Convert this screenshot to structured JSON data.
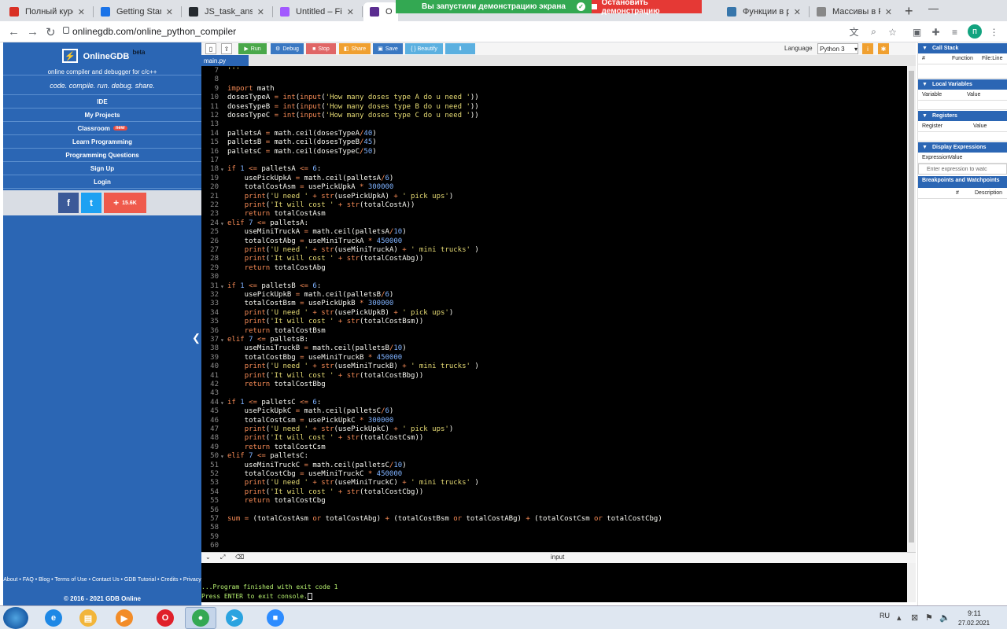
{
  "browser": {
    "tabs": [
      {
        "title": "Полный курс п",
        "icon": "edu-icon",
        "color": "#d93025"
      },
      {
        "title": "Getting Started",
        "icon": "globe-icon",
        "color": "#1a73e8"
      },
      {
        "title": "JS_task_answer",
        "icon": "github-icon",
        "color": "#24292e"
      },
      {
        "title": "Untitled – Figm",
        "icon": "figma-icon",
        "color": "#a259ff"
      },
      {
        "title": "Onli",
        "icon": "onlinegdb-icon",
        "color": "#5b2d90",
        "active": true
      },
      {
        "title": "Функции в pyth",
        "icon": "python-icon",
        "color": "#3776ab"
      },
      {
        "title": "Массивы в Pyth",
        "icon": "bookmark-icon",
        "color": "#888888"
      }
    ],
    "demo_banner": {
      "message": "Вы запустили демонстрацию экрана",
      "stop": "Остановить демонстрацию"
    },
    "url": "onlinegdb.com/online_python_compiler",
    "profile_initial": "п"
  },
  "sidebar": {
    "brand": "OnlineGDB",
    "beta": "beta",
    "subtitle": "online compiler and debugger for c/c++",
    "tagline": "code. compile. run. debug. share.",
    "items": [
      "IDE",
      "My Projects",
      "Classroom",
      "Learn Programming",
      "Programming Questions",
      "Sign Up",
      "Login"
    ],
    "new_badge": "new",
    "share_count": "15.6K",
    "footer_links": "About • FAQ • Blog • Terms of Use • Contact Us • GDB Tutorial • Credits • Privacy",
    "copyright": "© 2016 - 2021 GDB Online"
  },
  "toolbar": {
    "run": "Run",
    "debug": "Debug",
    "stop": "Stop",
    "share": "Share",
    "save": "Save",
    "beautify": "{ } Beautify",
    "language_label": "Language",
    "language": "Python 3",
    "colors": {
      "run": "#4aa84a",
      "debug": "#3a78c2",
      "stop": "#e06666",
      "share": "#f0a030",
      "save": "#3a78c2",
      "beautify": "#5bb0e0",
      "download": "#5bb0e0"
    }
  },
  "file_tab": "main.py",
  "code": {
    "first_line": 7,
    "lines": [
      "'''",
      "",
      "import math",
      "dosesTypeA = int(input('How many doses type A do u need '))",
      "dosesTypeB = int(input('How many doses type B do u need '))",
      "dosesTypeC = int(input('How many doses type C do u need '))",
      "",
      "palletsA = math.ceil(dosesTypeA/40)",
      "palletsB = math.ceil(dosesTypeB/45)",
      "palletsC = math.ceil(dosesTypeC/50)",
      "",
      "if 1 <= palletsA <= 6:",
      "    usePickUpkA = math.ceil(palletsA/6)",
      "    totalCostAsm = usePickUpkA * 300000",
      "    print('U need ' + str(usePickUpkA) + ' pick ups')",
      "    print('It will cost ' + str(totalCostA))",
      "    return totalCostAsm",
      "elif 7 <= palletsA:",
      "    useMiniTruckA = math.ceil(palletsA/10)",
      "    totalCostAbg = useMiniTruckA * 450000",
      "    print('U need ' + str(useMiniTruckA) + ' mini trucks' )",
      "    print('It will cost ' + str(totalCostAbg))",
      "    return totalCostAbg",
      "",
      "if 1 <= palletsB <= 6:",
      "    usePickUpkB = math.ceil(palletsB/6)",
      "    totalCostBsm = usePickUpkB * 300000",
      "    print('U need ' + str(usePickUpkB) + ' pick ups')",
      "    print('It will cost ' + str(totalCostBsm))",
      "    return totalCostBsm",
      "elif 7 <= palletsB:",
      "    useMiniTruckB = math.ceil(palletsB/10)",
      "    totalCostBbg = useMiniTruckB * 450000",
      "    print('U need ' + str(useMiniTruckB) + ' mini trucks' )",
      "    print('It will cost ' + str(totalCostBbg))",
      "    return totalCostBbg",
      "",
      "if 1 <= palletsC <= 6:",
      "    usePickUpkC = math.ceil(palletsC/6)",
      "    totalCostCsm = usePickUpkC * 300000",
      "    print('U need ' + str(usePickUpkC) + ' pick ups')",
      "    print('It will cost ' + str(totalCostCsm))",
      "    return totalCostCsm",
      "elif 7 <= palletsC:",
      "    useMiniTruckC = math.ceil(palletsC/10)",
      "    totalCostCbg = useMiniTruckC * 450000",
      "    print('U need ' + str(useMiniTruckC) + ' mini trucks' )",
      "    print('It will cost ' + str(totalCostCbg))",
      "    return totalCostCbg",
      "",
      "sum = (totalCostAsm or totalCostAbg) + (totalCostBsm or totalCostABg) + (totalCostCsm or totalCostCbg)",
      "",
      "",
      ""
    ]
  },
  "console": {
    "label": "input",
    "line1": "...Program finished with exit code 1",
    "line2": "Press ENTER to exit console."
  },
  "debug_panel": {
    "call_stack": "Call Stack",
    "cs_cols": [
      "#",
      "Function",
      "File:Line"
    ],
    "local_vars": "Local Variables",
    "lv_cols": [
      "Variable",
      "Value"
    ],
    "registers": "Registers",
    "reg_cols": [
      "Register",
      "Value"
    ],
    "display_expr": "Display Expressions",
    "de_cols": [
      "Expression",
      "Value"
    ],
    "de_placeholder": "Enter expression to watc",
    "breakpoints": "Breakpoints and Watchpoints",
    "bp_cols": [
      "#",
      "Description"
    ]
  },
  "taskbar": {
    "language": "RU",
    "time": "9:11",
    "date": "27.02.2021",
    "apps": [
      {
        "name": "ie-icon",
        "color": "#1e88e5",
        "glyph": "e"
      },
      {
        "name": "explorer-icon",
        "color": "#f2b53a",
        "glyph": "▤"
      },
      {
        "name": "media-player-icon",
        "color": "#f28c28",
        "glyph": "▶"
      },
      {
        "name": "opera-icon",
        "color": "#e0202a",
        "glyph": "O"
      },
      {
        "name": "chrome-icon",
        "color": "#34a853",
        "glyph": "●",
        "active": true
      },
      {
        "name": "telegram-icon",
        "color": "#2aa3e0",
        "glyph": "➤"
      },
      {
        "name": "zoom-icon",
        "color": "#2d8cff",
        "glyph": "■"
      }
    ]
  }
}
